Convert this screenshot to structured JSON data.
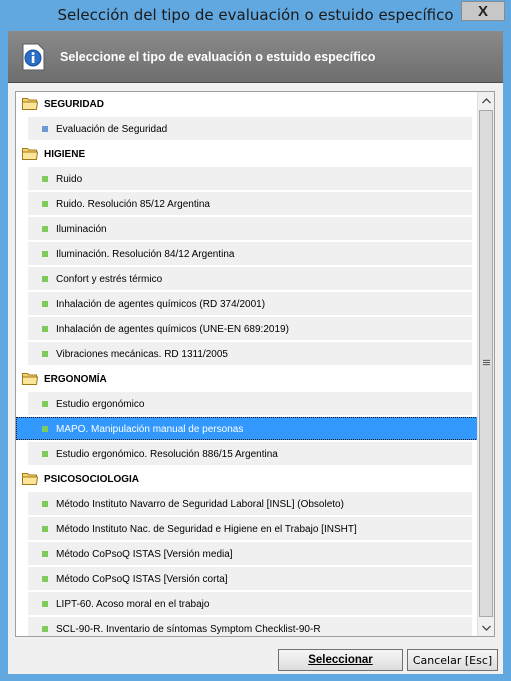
{
  "window": {
    "title": "Selección del tipo de evaluación o estuido específico",
    "close_label": "X"
  },
  "header": {
    "title": "Seleccione el tipo de evaluación o estuido específico"
  },
  "list": [
    {
      "type": "group",
      "label": "SEGURIDAD"
    },
    {
      "type": "item",
      "label": "Evaluación de Seguridad",
      "bullet": "blue"
    },
    {
      "type": "group",
      "label": "HIGIENE"
    },
    {
      "type": "item",
      "label": "Ruido"
    },
    {
      "type": "item",
      "label": "Ruido. Resolución 85/12 Argentina"
    },
    {
      "type": "item",
      "label": "Iluminación"
    },
    {
      "type": "item",
      "label": "Iluminación. Resolución 84/12 Argentina"
    },
    {
      "type": "item",
      "label": "Confort y estrés térmico"
    },
    {
      "type": "item",
      "label": "Inhalación de agentes químicos (RD 374/2001)"
    },
    {
      "type": "item",
      "label": "Inhalación de agentes químicos (UNE-EN 689:2019)"
    },
    {
      "type": "item",
      "label": "Vibraciones mecánicas. RD 1311/2005"
    },
    {
      "type": "group",
      "label": "ERGONOMÍA"
    },
    {
      "type": "item",
      "label": "Estudio ergonómico"
    },
    {
      "type": "item",
      "label": "MAPO. Manipulación manual de personas",
      "selected": true
    },
    {
      "type": "item",
      "label": "Estudio ergonómico. Resolución 886/15 Argentina"
    },
    {
      "type": "group",
      "label": "PSICOSOCIOLOGIA"
    },
    {
      "type": "item",
      "label": "Método Instituto Navarro de Seguridad Laboral  [INSL]  (Obsoleto)"
    },
    {
      "type": "item",
      "label": "Método Instituto Nac. de Seguridad e Higiene en el Trabajo  [INSHT]"
    },
    {
      "type": "item",
      "label": "Método CoPsoQ ISTAS  [Versión media]"
    },
    {
      "type": "item",
      "label": "Método CoPsoQ ISTAS  [Versión corta]"
    },
    {
      "type": "item",
      "label": "LIPT-60. Acoso moral en el trabajo"
    },
    {
      "type": "item",
      "label": "SCL-90-R. Inventario de síntomas Symptom Checklist-90-R"
    }
  ],
  "buttons": {
    "select_label": "Seleccionar",
    "cancel_label": "Cancelar  [Esc]"
  },
  "colors": {
    "selection": "#3399ff",
    "bullet_green": "#7ccc5c",
    "bullet_blue": "#6b9ad6",
    "titlebar": "#62a8e0"
  },
  "icons": {
    "header": "info-icon",
    "group": "folder-icon"
  }
}
